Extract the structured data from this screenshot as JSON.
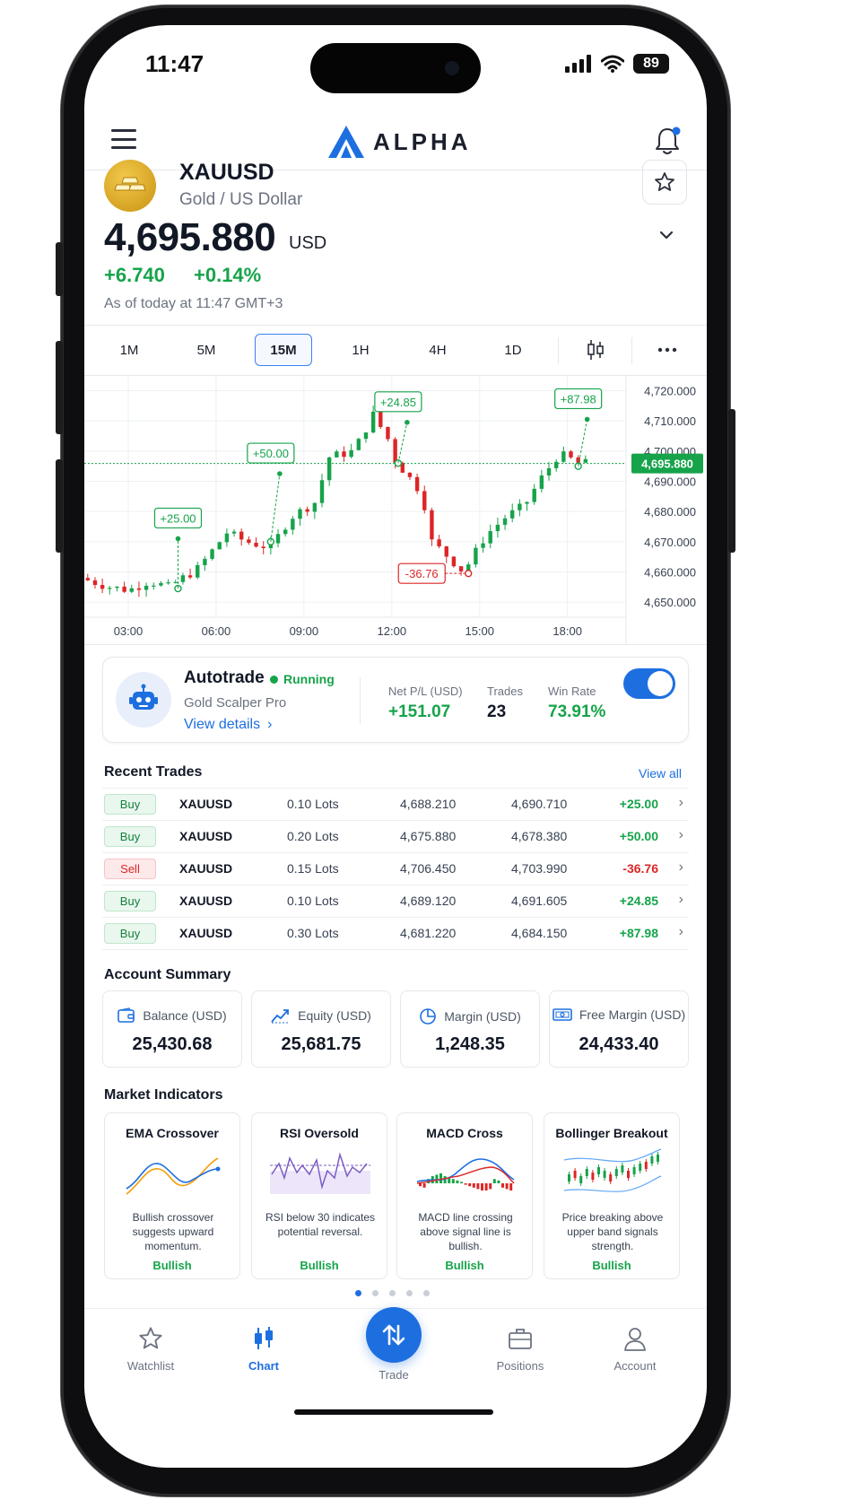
{
  "status": {
    "time": "11:47",
    "battery": "89"
  },
  "header": {
    "brand": "ALPHA"
  },
  "instrument": {
    "symbol": "XAUUSD",
    "name": "Gold / US Dollar",
    "price": "4,695.880",
    "currency": "USD",
    "change": "+6.740",
    "change_pct": "+0.14%",
    "as_of": "As of today at 11:47 GMT+3"
  },
  "timeframes": [
    "1M",
    "5M",
    "15M",
    "1H",
    "4H",
    "1D"
  ],
  "active_timeframe": "15M",
  "chart": {
    "y_ticks": [
      "4,720.000",
      "4,710.000",
      "4,700.000",
      "4,690.000",
      "4,680.000",
      "4,670.000",
      "4,660.000",
      "4,650.000"
    ],
    "x_ticks": [
      "03:00",
      "06:00",
      "09:00",
      "12:00",
      "15:00",
      "18:00"
    ],
    "current_label": "4,695.880",
    "current_price": 4695.88,
    "ylim": [
      4645,
      4724
    ],
    "markers": [
      {
        "label": "+25.00",
        "time": "04:42",
        "entry": 4654.5,
        "exit": 4671.0,
        "color": "#16a34a"
      },
      {
        "label": "+50.00",
        "time": "07:52",
        "entry": 4670.0,
        "exit": 4692.5,
        "color": "#16a34a"
      },
      {
        "label": "+24.85",
        "time": "12:13",
        "entry": 4696.0,
        "exit": 4709.5,
        "color": "#16a34a"
      },
      {
        "label": "-36.76",
        "time": "14:37",
        "entry": 4659.5,
        "exit": 4659.5,
        "color": "#dc2626"
      },
      {
        "label": "+87.98",
        "time": "18:22",
        "entry": 4695.0,
        "exit": 4710.5,
        "color": "#16a34a"
      }
    ]
  },
  "autotrade": {
    "title": "Autotrade",
    "status": "Running",
    "strategy": "Gold Scalper Pro",
    "link": "View details",
    "net_pl_label": "Net P/L (USD)",
    "net_pl": "+151.07",
    "trades_label": "Trades",
    "trades": "23",
    "win_rate_label": "Win Rate",
    "win_rate": "73.91%",
    "enabled": true
  },
  "recent_trades": {
    "title": "Recent Trades",
    "view_all": "View all",
    "rows": [
      {
        "side": "Buy",
        "symbol": "XAUUSD",
        "lots": "0.10 Lots",
        "open": "4,688.210",
        "close": "4,690.710",
        "pnl": "+25.00"
      },
      {
        "side": "Buy",
        "symbol": "XAUUSD",
        "lots": "0.20 Lots",
        "open": "4,675.880",
        "close": "4,678.380",
        "pnl": "+50.00"
      },
      {
        "side": "Sell",
        "symbol": "XAUUSD",
        "lots": "0.15 Lots",
        "open": "4,706.450",
        "close": "4,703.990",
        "pnl": "-36.76"
      },
      {
        "side": "Buy",
        "symbol": "XAUUSD",
        "lots": "0.10 Lots",
        "open": "4,689.120",
        "close": "4,691.605",
        "pnl": "+24.85"
      },
      {
        "side": "Buy",
        "symbol": "XAUUSD",
        "lots": "0.30 Lots",
        "open": "4,681.220",
        "close": "4,684.150",
        "pnl": "+87.98"
      }
    ]
  },
  "account_summary": {
    "title": "Account Summary",
    "cards": [
      {
        "label": "Balance (USD)",
        "value": "25,430.68",
        "icon": "wallet-icon"
      },
      {
        "label": "Equity (USD)",
        "value": "25,681.75",
        "icon": "trend-icon"
      },
      {
        "label": "Margin (USD)",
        "value": "1,248.35",
        "icon": "pie-icon"
      },
      {
        "label": "Free Margin (USD)",
        "value": "24,433.40",
        "icon": "cash-icon"
      }
    ]
  },
  "market_indicators": {
    "title": "Market Indicators",
    "cards": [
      {
        "title": "EMA Crossover",
        "desc": "Bullish crossover suggests upward momentum.",
        "signal": "Bullish"
      },
      {
        "title": "RSI Oversold",
        "desc": "RSI below 30 indicates potential reversal.",
        "signal": "Bullish"
      },
      {
        "title": "MACD Cross",
        "desc": "MACD line crossing above signal line is bullish.",
        "signal": "Bullish"
      },
      {
        "title": "Bollinger Breakout",
        "desc": "Price breaking above upper band signals strength.",
        "signal": "Bullish"
      }
    ]
  },
  "nav": {
    "items": [
      "Watchlist",
      "Chart",
      "Trade",
      "Positions",
      "Account"
    ],
    "active": "Chart"
  },
  "colors": {
    "accent": "#1d6fe0",
    "up": "#16a34a",
    "down": "#dc2626"
  }
}
